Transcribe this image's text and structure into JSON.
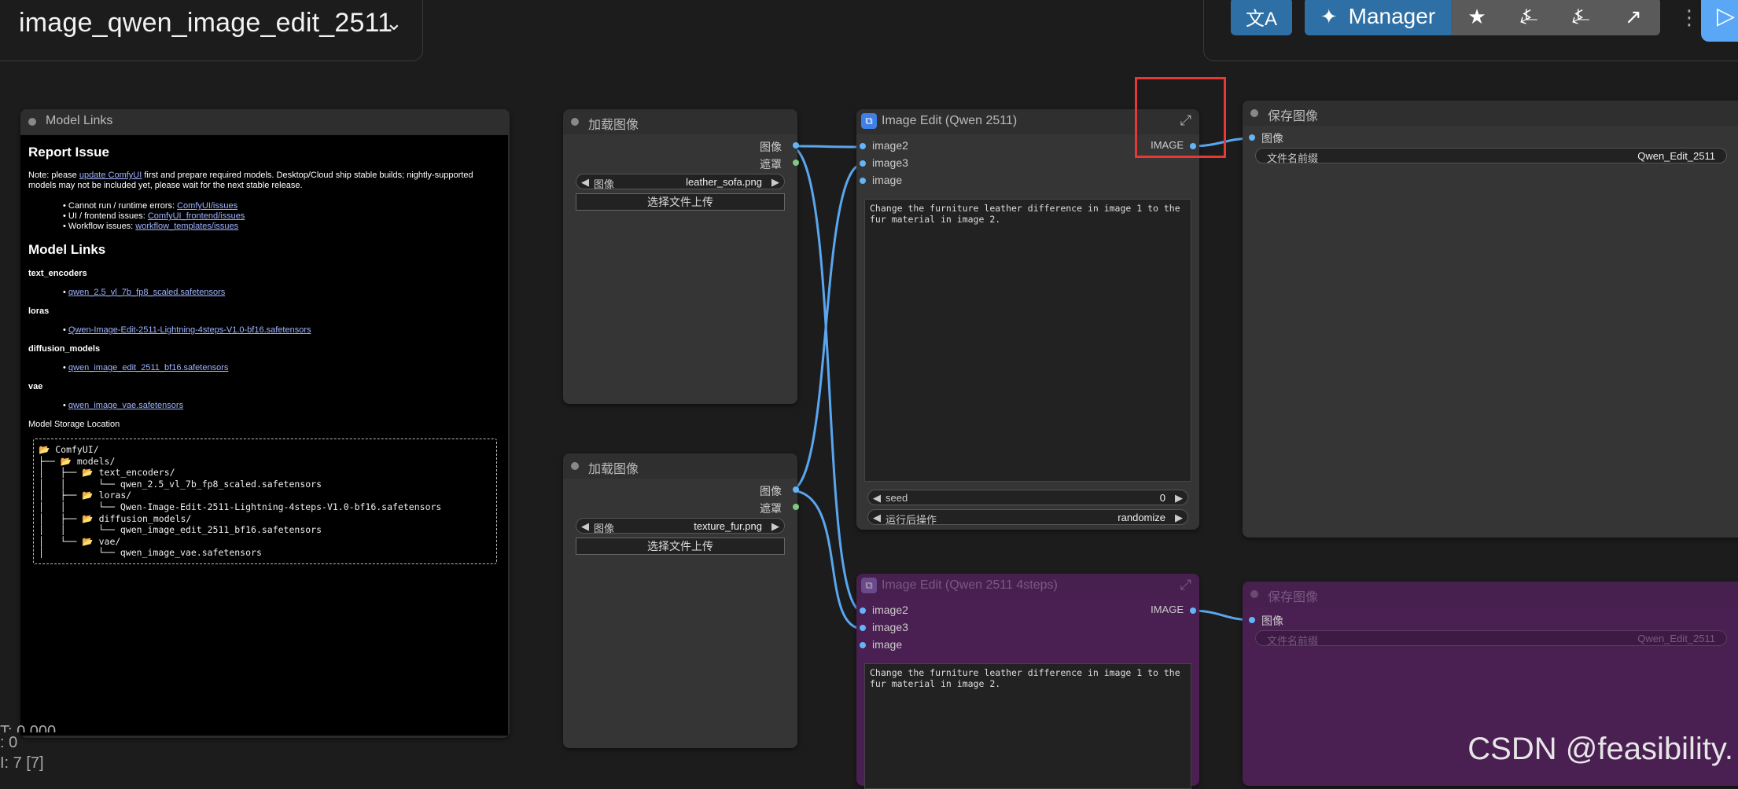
{
  "workflow": {
    "title": "image_qwen_image_edit_2511"
  },
  "toolbar": {
    "translate_icon": "文A",
    "manager_label": "Manager",
    "share_icon": "↗"
  },
  "model_links_node": {
    "title": "Model Links",
    "report_heading": "Report Issue",
    "note_prefix": "Note: please ",
    "note_link": "update ComfyUI",
    "note_suffix": " first and prepare required models. Desktop/Cloud ship stable builds; nightly-supported models may not be included yet, please wait for the next stable release.",
    "issues": [
      {
        "label": "Cannot run / runtime errors: ",
        "link": "ComfyUI/issues"
      },
      {
        "label": "UI / frontend issues: ",
        "link": "ComfyUI_frontend/issues"
      },
      {
        "label": "Workflow issues: ",
        "link": "workflow_templates/issues"
      }
    ],
    "models_heading": "Model Links",
    "groups": [
      {
        "name": "text_encoders",
        "file": "qwen_2.5_vl_7b_fp8_scaled.safetensors"
      },
      {
        "name": "loras",
        "file": "Qwen-Image-Edit-2511-Lightning-4steps-V1.0-bf16.safetensors"
      },
      {
        "name": "diffusion_models",
        "file": "qwen_image_edit_2511_bf16.safetensors"
      },
      {
        "name": "vae",
        "file": "qwen_image_vae.safetensors"
      }
    ],
    "storage_heading": "Model Storage Location",
    "tree": [
      "📂 ComfyUI/",
      "├── 📂 models/",
      "│   ├── 📂 text_encoders/",
      "│   │      └── qwen_2.5_vl_7b_fp8_scaled.safetensors",
      "│   ├── 📂 loras/",
      "│   │      └── Qwen-Image-Edit-2511-Lightning-4steps-V1.0-bf16.safetensors",
      "│   ├── 📂 diffusion_models/",
      "│   │      └── qwen_image_edit_2511_bf16.safetensors",
      "│   └── 📂 vae/",
      "│          └── qwen_image_vae.safetensors"
    ]
  },
  "load_image_1": {
    "title": "加载图像",
    "out_image": "图像",
    "out_mask": "遮罩",
    "widget_label": "图像",
    "widget_value": "leather_sofa.png",
    "upload_label": "选择文件上传"
  },
  "load_image_2": {
    "title": "加载图像",
    "out_image": "图像",
    "out_mask": "遮罩",
    "widget_label": "图像",
    "widget_value": "texture_fur.png",
    "upload_label": "选择文件上传"
  },
  "image_edit": {
    "title": "Image Edit (Qwen 2511)",
    "inputs": [
      "image2",
      "image3",
      "image"
    ],
    "output": "IMAGE",
    "prompt": "Change the furniture leather difference in image 1 to the fur material in image 2.",
    "seed_label": "seed",
    "seed_value": "0",
    "after_label": "运行后操作",
    "after_value": "randomize"
  },
  "image_edit_4steps": {
    "title": "Image Edit (Qwen 2511 4steps)",
    "inputs": [
      "image2",
      "image3",
      "image"
    ],
    "output": "IMAGE",
    "prompt": "Change the furniture leather difference in image 1 to the fur material in image 2."
  },
  "save_image_1": {
    "title": "保存图像",
    "input": "图像",
    "prefix_label": "文件名前缀",
    "prefix_value": "Qwen_Edit_2511"
  },
  "save_image_2": {
    "title": "保存图像",
    "input": "图像",
    "prefix_label": "文件名前缀",
    "prefix_value": "Qwen_Edit_2511"
  },
  "stats": {
    "line1": "T: 0.000",
    "line2": ": 0",
    "line3": "I: 7 [7]"
  },
  "watermark": "CSDN @feasibility."
}
